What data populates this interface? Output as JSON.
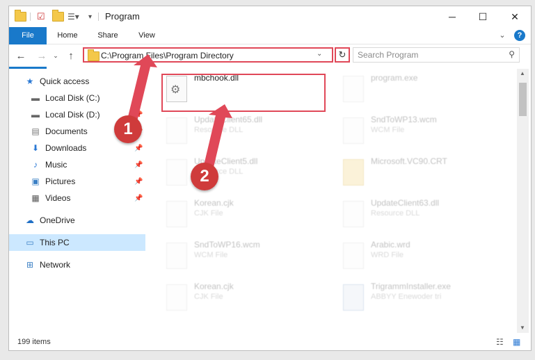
{
  "window": {
    "title": "Program"
  },
  "ribbon": {
    "file": "File",
    "home": "Home",
    "share": "Share",
    "view": "View"
  },
  "address": {
    "path": "C:\\Program Files\\Program Directory"
  },
  "search": {
    "placeholder": "Search Program"
  },
  "sidebar": {
    "items": [
      {
        "label": "Quick access",
        "icon": "star-icon"
      },
      {
        "label": "Local Disk (C:)",
        "icon": "disk-icon"
      },
      {
        "label": "Local Disk (D:)",
        "icon": "disk-icon"
      },
      {
        "label": "Documents",
        "icon": "documents-icon"
      },
      {
        "label": "Downloads",
        "icon": "downloads-icon"
      },
      {
        "label": "Music",
        "icon": "music-icon"
      },
      {
        "label": "Pictures",
        "icon": "pictures-icon"
      },
      {
        "label": "Videos",
        "icon": "videos-icon"
      },
      {
        "label": "OneDrive",
        "icon": "cloud-icon"
      },
      {
        "label": "This PC",
        "icon": "computer-icon"
      },
      {
        "label": "Network",
        "icon": "network-icon"
      }
    ]
  },
  "files": [
    {
      "name": "mbchook.dll",
      "type": ""
    },
    {
      "name": "program.exe",
      "type": ""
    },
    {
      "name": "UpdateClient65.dll",
      "type": "Resource DLL"
    },
    {
      "name": "SndToWP13.wcm",
      "type": "WCM File"
    },
    {
      "name": "UpdateClient5.dll",
      "type": "Resource DLL"
    },
    {
      "name": "Microsoft.VC90.CRT",
      "type": ""
    },
    {
      "name": "Korean.cjk",
      "type": "CJK File"
    },
    {
      "name": "UpdateClient63.dll",
      "type": "Resource DLL"
    },
    {
      "name": "SndToWP16.wcm",
      "type": "WCM File"
    },
    {
      "name": "Arabic.wrd",
      "type": "WRD File"
    },
    {
      "name": "Korean.cjk",
      "type": "CJK File"
    },
    {
      "name": "TrigrammInstaller.exe",
      "type": "ABBYY Enewoder tri"
    }
  ],
  "status": {
    "count": "199 items"
  },
  "annotations": {
    "step1": "1",
    "step2": "2",
    "color": "#e04858"
  }
}
